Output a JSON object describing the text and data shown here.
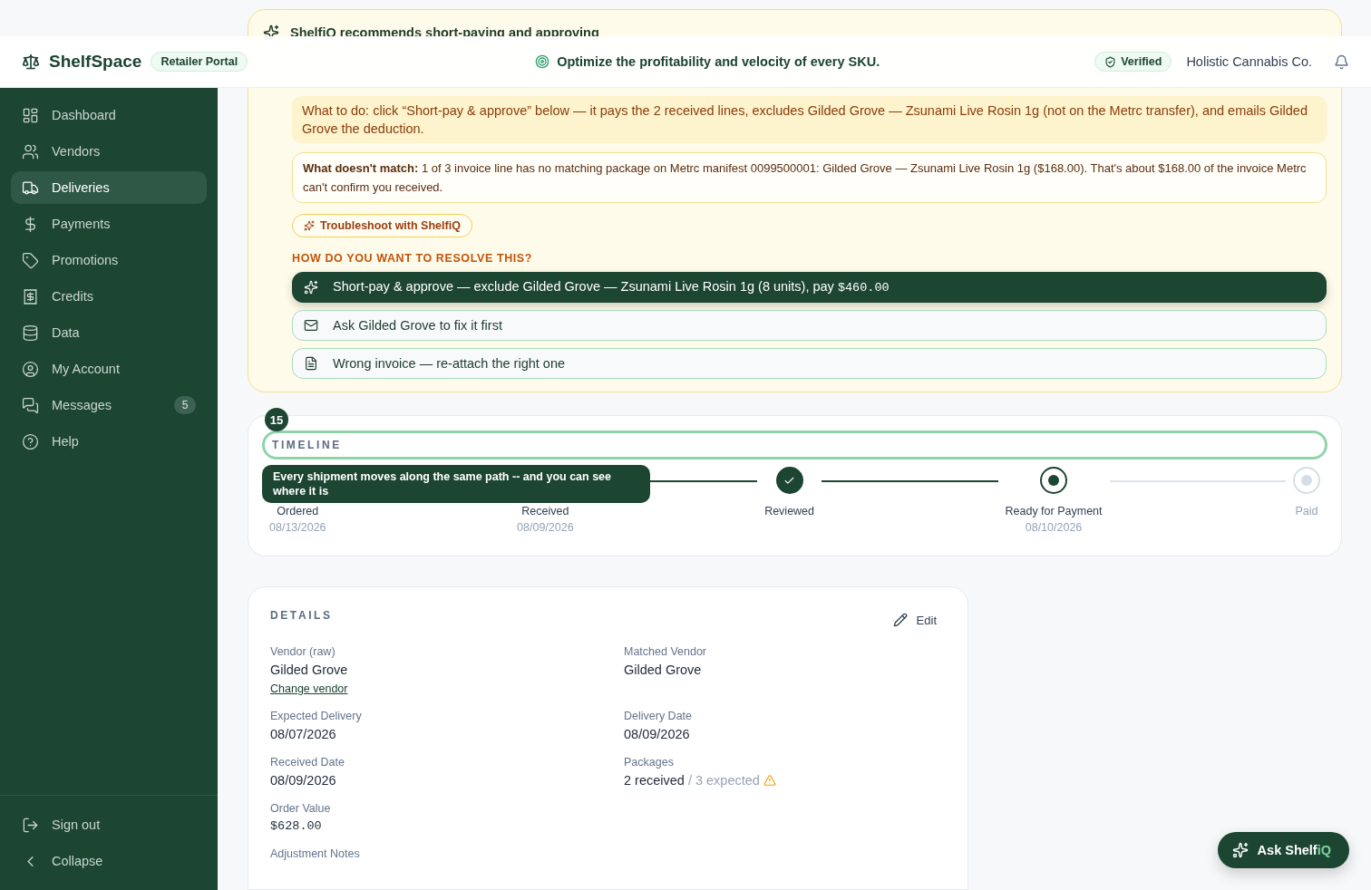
{
  "header": {
    "brand": "ShelfSpace",
    "portal": "Retailer Portal",
    "tagline": "Optimize the profitability and velocity of every SKU.",
    "verified": "Verified",
    "account": "Holistic Cannabis Co."
  },
  "sidebar": {
    "items": [
      {
        "label": "Dashboard",
        "selected": false
      },
      {
        "label": "Vendors",
        "selected": false
      },
      {
        "label": "Deliveries",
        "selected": true
      },
      {
        "label": "Payments",
        "selected": false
      },
      {
        "label": "Promotions",
        "selected": false
      },
      {
        "label": "Credits",
        "selected": false
      },
      {
        "label": "Data",
        "selected": false
      },
      {
        "label": "My Account",
        "selected": false
      },
      {
        "label": "Messages",
        "selected": false,
        "badge": "5"
      },
      {
        "label": "Help",
        "selected": false
      }
    ],
    "footer": [
      {
        "label": "Sign out"
      },
      {
        "label": "Collapse"
      }
    ]
  },
  "recommendation": {
    "title": "ShelfiQ recommends short-paying and approving",
    "what_to_do": "What to do: click “Short-pay & approve” below — it pays the 2 received lines, excludes Gilded Grove — Zsunami Live Rosin 1g (not on the Metrc transfer), and emails Gilded Grove the deduction.",
    "mismatch": "**What doesn't match:** 1 of 3 invoice line has no matching package on Metrc manifest 0099500001: Gilded Grove — Zsunami Live Rosin 1g ($168.00). That's about $168.00 of the invoice Metrc can't confirm you received.",
    "troubleshoot": "Troubleshoot with ShelfiQ",
    "question": "HOW DO YOU WANT TO RESOLVE THIS?",
    "options": [
      {
        "kind": "sparkle",
        "label": "Short-pay & approve — exclude Gilded Grove — Zsunami Live Rosin 1g (8 units), pay ",
        "amount": "$460.00",
        "selected": true
      },
      {
        "kind": "mail",
        "label": "Ask Gilded Grove to fix it first",
        "selected": false
      },
      {
        "kind": "file",
        "label": "Wrong invoice — re-attach the right one",
        "selected": false
      }
    ]
  },
  "timeline": {
    "title": "TIMELINE",
    "steps": [
      {
        "label": "Ordered",
        "date": "08/13/2026"
      },
      {
        "label": "Received",
        "date": "08/09/2026"
      },
      {
        "label": "Reviewed",
        "kind": "done"
      },
      {
        "label": "Ready for Payment",
        "date": "08/10/2026",
        "kind": "current"
      },
      {
        "label": "Paid",
        "kind": "pending"
      }
    ]
  },
  "tour": {
    "step": "15",
    "tip": "Every shipment moves along the same path -- and you can see where it is"
  },
  "details": {
    "title": "DETAILS",
    "edit": "Edit",
    "rows": [
      [
        {
          "label": "Vendor (raw)",
          "value": "Gilded Grove",
          "link": "Change vendor"
        },
        {
          "label": "Matched Vendor",
          "value": "Gilded Grove"
        }
      ],
      [
        {
          "label": "Expected Delivery",
          "value": "08/07/2026"
        },
        {
          "label": "Delivery Date",
          "value": "08/09/2026"
        }
      ],
      [
        {
          "label": "Received Date",
          "value": "08/09/2026"
        },
        {
          "label": "Packages",
          "value": "2 received",
          "muted": " / 3 expected",
          "warning": true
        }
      ],
      [
        {
          "label": "Order Value",
          "value": "$628.00",
          "kind": "money"
        }
      ],
      [
        {
          "label": "Adjustment Notes"
        }
      ]
    ]
  },
  "assistant": {
    "label": "Ask Shelf",
    "accent": "iQ"
  }
}
